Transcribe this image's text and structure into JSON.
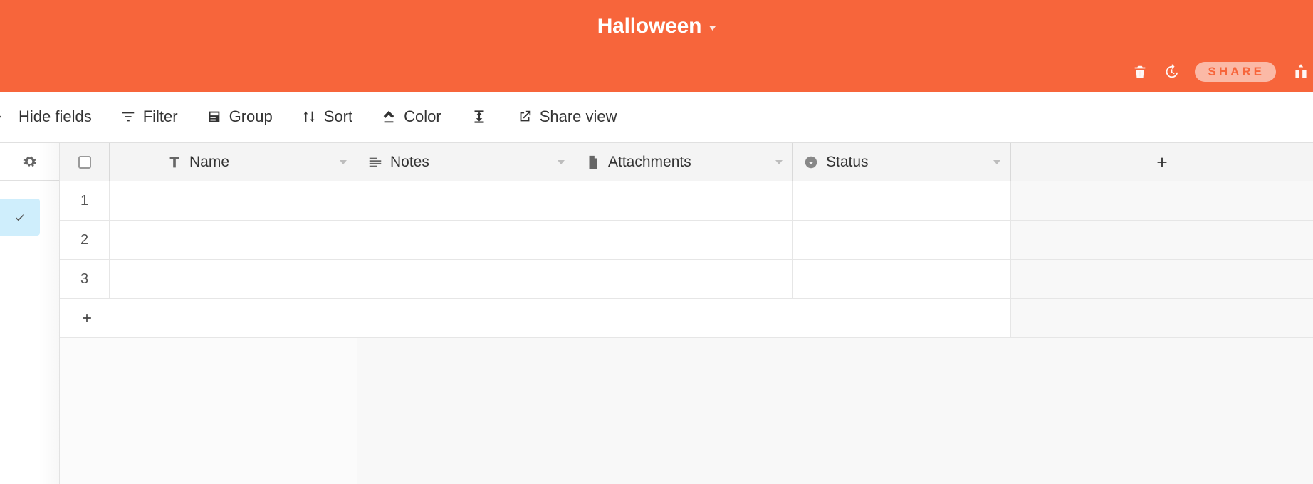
{
  "header": {
    "title": "Halloween",
    "share_label": "SHARE"
  },
  "toolbar": {
    "hide_fields": "Hide fields",
    "filter": "Filter",
    "group": "Group",
    "sort": "Sort",
    "color": "Color",
    "share_view": "Share view"
  },
  "columns": [
    {
      "label": "Name",
      "type": "text"
    },
    {
      "label": "Notes",
      "type": "longtext"
    },
    {
      "label": "Attachments",
      "type": "attachment"
    },
    {
      "label": "Status",
      "type": "select"
    }
  ],
  "rows": [
    {
      "num": "1"
    },
    {
      "num": "2"
    },
    {
      "num": "3"
    }
  ],
  "colors": {
    "accent": "#f7653b",
    "view_active_bg": "#cfeefc"
  }
}
